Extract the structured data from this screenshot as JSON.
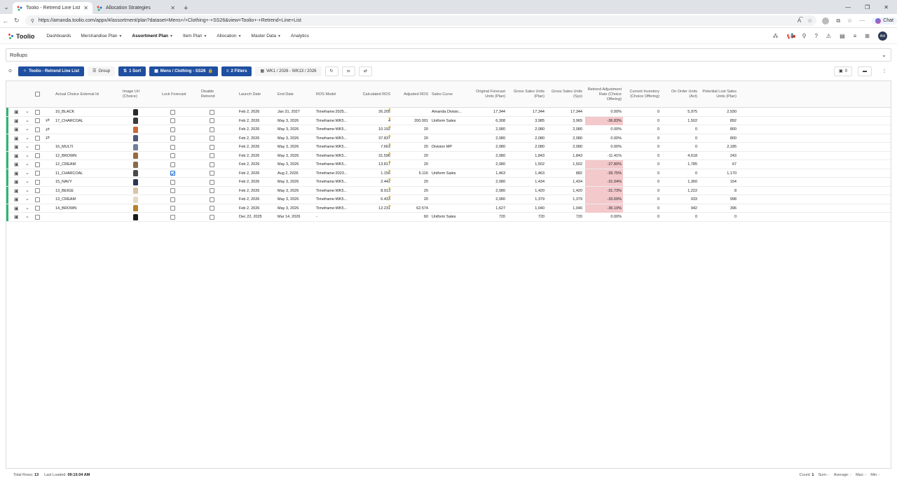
{
  "browser": {
    "tabs": [
      {
        "title": "Toolio - Retrend Line List - Assortm"
      },
      {
        "title": "Allocation Strategies"
      }
    ],
    "url": "https://amanda.toolio.com/appx/#/assortment/plan?dataset=Mens+/+Clothing+-+SS26&view=Toolio+-+Retrend+Line+List",
    "chat_label": "Chat"
  },
  "app": {
    "logo_text": "Toolio",
    "nav": [
      {
        "label": "Dashboards",
        "caret": false,
        "active": false
      },
      {
        "label": "Merchandise Plan",
        "caret": true,
        "active": false
      },
      {
        "label": "Assortment Plan",
        "caret": true,
        "active": true
      },
      {
        "label": "Item Plan",
        "caret": true,
        "active": false
      },
      {
        "label": "Allocation",
        "caret": true,
        "active": false
      },
      {
        "label": "Master Data",
        "caret": true,
        "active": false
      },
      {
        "label": "Analytics",
        "caret": false,
        "active": false
      }
    ],
    "avatar": "AH"
  },
  "rollups": {
    "label": "Rollups"
  },
  "toolbar": {
    "view_label": "Toolio - Retrend Line List",
    "group_label": "Group",
    "sort_label": "1 Sort",
    "dataset_label": "Mens / Clothing - SS26",
    "filters_label": "2 Filters",
    "date_range": "WK1 / 2026 - WK13 / 2026",
    "comments_count": "0"
  },
  "columns": [
    "Actual Choice External Id",
    "Image Url (Choice)",
    "Lock Forecast",
    "Disable Retrend",
    "Launch Date",
    "End Date",
    "ROS Model",
    "Calculated ROS",
    "Adjusted ROS",
    "Sales Curve",
    "Original Forecast Units (Plan)",
    "Gross Sales Units (Plan)",
    "Gross Sales Units (Sys)",
    "Retrend Adjustment Rate (Choice Offering)",
    "Current Inventory (Choice Offering)",
    "On Order Units (Act)",
    "Potential Lost Sales Units (Plan)"
  ],
  "rows": [
    {
      "id": "10_BLACK",
      "thumb": "#2a2a2a",
      "lock": false,
      "disable": false,
      "launch": "Feb 2, 2026",
      "end": "Jan 31, 2027",
      "ros": "Timeframe:2025...",
      "calc": "26.205",
      "adj": "",
      "curve": "Amanda Divisio...",
      "orig": "17,344",
      "gplan": "17,344",
      "gsys": "17,344",
      "rate": "0.00%",
      "neg": false,
      "inv": "0",
      "onorder": "5,975",
      "lost": "2,930",
      "bar": "#2bb673",
      "swap": false,
      "triAdj": true
    },
    {
      "id": "17_CHARCOAL",
      "thumb": "#3a3a3a",
      "lock": false,
      "disable": false,
      "launch": "Feb 2, 2026",
      "end": "May 3, 2026",
      "ros": "Timeframe:WK5...",
      "calc": "4",
      "adj": "200.001",
      "curve": "Uniform Sales",
      "orig": "6,308",
      "gplan": "3,985",
      "gsys": "3,965",
      "rate": "-36.83%",
      "neg": true,
      "inv": "0",
      "onorder": "1,502",
      "lost": "892",
      "bar": "#2bb673",
      "swap": true,
      "triAdj": true
    },
    {
      "id": "",
      "thumb": "#c9693a",
      "lock": false,
      "disable": false,
      "launch": "Feb 2, 2026",
      "end": "May 3, 2026",
      "ros": "Timeframe:WK5...",
      "calc": "10.192",
      "adj": "20",
      "curve": "",
      "orig": "2,080",
      "gplan": "2,080",
      "gsys": "2,080",
      "rate": "0.00%",
      "neg": false,
      "inv": "0",
      "onorder": "0",
      "lost": "800",
      "bar": "#2bb673",
      "swap": true,
      "triAdj": true
    },
    {
      "id": "",
      "thumb": "#4a5a78",
      "lock": false,
      "disable": false,
      "launch": "Feb 2, 2026",
      "end": "May 3, 2026",
      "ros": "Timeframe:WK5...",
      "calc": "37.837",
      "adj": "20",
      "curve": "",
      "orig": "2,080",
      "gplan": "2,080",
      "gsys": "2,080",
      "rate": "0.00%",
      "neg": false,
      "inv": "0",
      "onorder": "0",
      "lost": "800",
      "bar": "#2bb673",
      "swap": true,
      "triAdj": true
    },
    {
      "id": "16_MULTI",
      "thumb": "#6f7f99",
      "lock": false,
      "disable": false,
      "launch": "Feb 2, 2026",
      "end": "May 3, 2026",
      "ros": "Timeframe:WK5...",
      "calc": "7.663",
      "adj": "20",
      "curve": "Division MP",
      "orig": "2,080",
      "gplan": "2,080",
      "gsys": "2,080",
      "rate": "0.00%",
      "neg": false,
      "inv": "0",
      "onorder": "0",
      "lost": "2,185",
      "bar": "#2bb673",
      "swap": false,
      "triAdj": true
    },
    {
      "id": "12_BROWN",
      "thumb": "#9a6a42",
      "lock": false,
      "disable": false,
      "launch": "Feb 2, 2026",
      "end": "May 3, 2026",
      "ros": "Timeframe:WK5...",
      "calc": "31.596",
      "adj": "20",
      "curve": "",
      "orig": "2,080",
      "gplan": "1,843",
      "gsys": "1,843",
      "rate": "-11.41%",
      "neg": false,
      "inv": "0",
      "onorder": "4,618",
      "lost": "243",
      "bar": "#2bb673",
      "swap": false,
      "triAdj": true
    },
    {
      "id": "12_CREAM",
      "thumb": "#8a6a4a",
      "lock": false,
      "disable": false,
      "launch": "Feb 2, 2026",
      "end": "May 3, 2026",
      "ros": "Timeframe:WK5...",
      "calc": "13.817",
      "adj": "20",
      "curve": "",
      "orig": "2,080",
      "gplan": "1,502",
      "gsys": "1,502",
      "rate": "-27.80%",
      "neg": true,
      "inv": "0",
      "onorder": "1,785",
      "lost": "67",
      "bar": "#2bb673",
      "swap": false,
      "triAdj": true
    },
    {
      "id": "11_CHARCOAL",
      "thumb": "#4a4a4a",
      "lock": true,
      "disable": false,
      "launch": "Feb 2, 2026",
      "end": "Aug 2, 2026",
      "ros": "Timeframe:2023...",
      "calc": "1.156",
      "adj": "5.116",
      "curve": "Uniform Sales",
      "orig": "1,463",
      "gplan": "1,463",
      "gsys": "882",
      "rate": "-39.75%",
      "neg": true,
      "inv": "0",
      "onorder": "0",
      "lost": "1,170",
      "bar": "#2bb673",
      "swap": false,
      "triAdj": true
    },
    {
      "id": "15_NAVY",
      "thumb": "#2c3850",
      "lock": false,
      "disable": false,
      "launch": "Feb 2, 2026",
      "end": "May 3, 2026",
      "ros": "Timeframe:WK5...",
      "calc": "2.442",
      "adj": "20",
      "curve": "",
      "orig": "2,080",
      "gplan": "1,434",
      "gsys": "1,434",
      "rate": "-31.04%",
      "neg": true,
      "inv": "0",
      "onorder": "1,360",
      "lost": "154",
      "bar": "#2bb673",
      "swap": false,
      "triAdj": true
    },
    {
      "id": "13_BEIGE",
      "thumb": "#d8c4a8",
      "lock": false,
      "disable": false,
      "launch": "Feb 2, 2026",
      "end": "May 3, 2026",
      "ros": "Timeframe:WK5...",
      "calc": "8.913",
      "adj": "20",
      "curve": "",
      "orig": "2,080",
      "gplan": "1,420",
      "gsys": "1,420",
      "rate": "-31.73%",
      "neg": true,
      "inv": "0",
      "onorder": "1,222",
      "lost": "8",
      "bar": "#2bb673",
      "swap": false,
      "triAdj": true
    },
    {
      "id": "13_CREAM",
      "thumb": "#e6d9c4",
      "lock": false,
      "disable": false,
      "launch": "Feb 2, 2026",
      "end": "May 3, 2026",
      "ros": "Timeframe:WK5...",
      "calc": "6.433",
      "adj": "20",
      "curve": "",
      "orig": "2,080",
      "gplan": "1,379",
      "gsys": "1,379",
      "rate": "-33.69%",
      "neg": true,
      "inv": "0",
      "onorder": "933",
      "lost": "998",
      "bar": "#2bb673",
      "swap": false,
      "triAdj": true
    },
    {
      "id": "14_BROWN",
      "thumb": "#b5822a",
      "lock": false,
      "disable": false,
      "launch": "Feb 2, 2026",
      "end": "May 3, 2026",
      "ros": "Timeframe:WK5...",
      "calc": "12.231",
      "adj": "62.574",
      "curve": "",
      "orig": "1,627",
      "gplan": "1,040",
      "gsys": "1,040",
      "rate": "-36.10%",
      "neg": true,
      "inv": "0",
      "onorder": "942",
      "lost": "396",
      "bar": "#2bb673",
      "swap": false,
      "triAdj": true
    },
    {
      "id": "",
      "thumb": "#1a1a1a",
      "lock": false,
      "disable": false,
      "launch": "Dec 22, 2025",
      "end": "Mar 14, 2026",
      "ros": "-",
      "calc": "",
      "adj": "60",
      "curve": "Uniform Sales",
      "orig": "720",
      "gplan": "720",
      "gsys": "720",
      "rate": "0.00%",
      "neg": false,
      "inv": "0",
      "onorder": "0",
      "lost": "0",
      "bar": "#2bb673",
      "swap": false,
      "triAdj": false
    }
  ],
  "footer": {
    "total_rows_label": "Total Rows:",
    "total_rows": "13",
    "last_loaded_label": "Last Loaded:",
    "last_loaded": "09:15:04 AM",
    "count_label": "Count:",
    "count": "1",
    "sum_label": "Sum: -",
    "avg_label": "Average: -",
    "max_label": "Max: -",
    "min_label": "Min: -"
  },
  "colors": {
    "primary": "#1f4fa0",
    "negative_bg": "#f3c9cc",
    "row_marker": "#2bb673"
  }
}
